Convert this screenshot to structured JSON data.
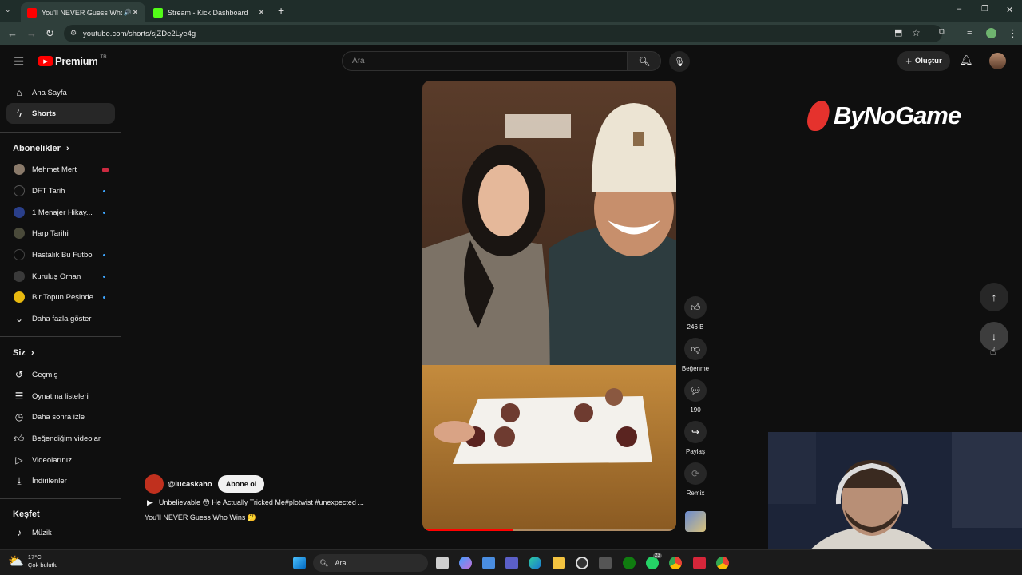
{
  "browser": {
    "tabs": [
      {
        "title": "You'll NEVER Guess Who W",
        "active": true,
        "color": "#ff0000"
      },
      {
        "title": "Stream - Kick Dashboard",
        "active": false,
        "color": "#53fc18"
      }
    ],
    "url": "youtube.com/shorts/sjZDe2Lye4g"
  },
  "header": {
    "logo": "Premium",
    "region": "TR",
    "search_placeholder": "Ara",
    "create_label": "Oluştur"
  },
  "sidebar": {
    "main": [
      {
        "label": "Ana Sayfa",
        "icon": "home-icon"
      },
      {
        "label": "Shorts",
        "icon": "shorts-icon",
        "selected": true
      }
    ],
    "subscriptions_title": "Abonelikler",
    "subscriptions": [
      {
        "label": "Mehmet Mert",
        "live": true
      },
      {
        "label": "DFT Tarih",
        "new": true
      },
      {
        "label": "1 Menajer Hikay...",
        "new": true
      },
      {
        "label": "Harp Tarihi",
        "new": false
      },
      {
        "label": "Hastalık Bu Futbol",
        "new": true
      },
      {
        "label": "Kuruluş Orhan",
        "new": true
      },
      {
        "label": "Bir Topun Peşinde",
        "new": true
      }
    ],
    "show_more": "Daha fazla göster",
    "you_title": "Siz",
    "you": [
      {
        "label": "Geçmiş",
        "icon": "history-icon"
      },
      {
        "label": "Oynatma listeleri",
        "icon": "playlists-icon"
      },
      {
        "label": "Daha sonra izle",
        "icon": "watch-later-icon"
      },
      {
        "label": "Beğendiğim videolar",
        "icon": "liked-icon"
      },
      {
        "label": "Videolarınız",
        "icon": "your-videos-icon"
      },
      {
        "label": "İndirilenler",
        "icon": "downloads-icon"
      }
    ],
    "explore_title": "Keşfet",
    "explore": [
      {
        "label": "Müzik",
        "icon": "music-icon"
      }
    ]
  },
  "short": {
    "channel": "@lucaskaho",
    "subscribe_label": "Abone ol",
    "caption": "Unbelievable 😳 He Actually Tricked Me#plotwist #unexpected ...",
    "title": "You'll NEVER Guess Who Wins 🤔",
    "likes": "246 B",
    "dislike_label": "Beğenme",
    "comments": "190",
    "share_label": "Paylaş",
    "remix_label": "Remix",
    "progress": 0.36
  },
  "overlay": {
    "brand": "ByNoGame"
  },
  "taskbar": {
    "weather_temp": "17°C",
    "weather_desc": "Çok bulutlu",
    "search_label": "Ara",
    "badge_count": "23"
  }
}
